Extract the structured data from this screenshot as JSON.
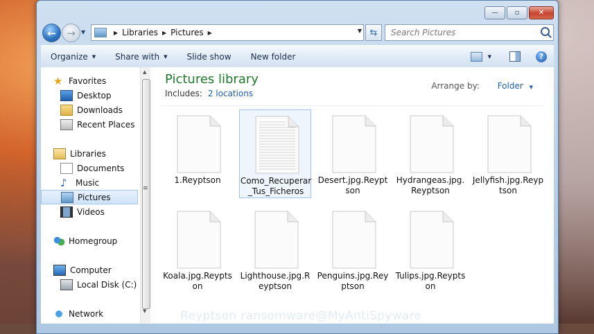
{
  "window": {
    "caption_minimize": "—",
    "caption_maximize": "▫",
    "caption_close": "✕"
  },
  "address_bar": {
    "breadcrumbs": [
      "Libraries",
      "Pictures"
    ],
    "search_placeholder": "Search Pictures"
  },
  "toolbar": {
    "organize": "Organize",
    "share_with": "Share with",
    "slide_show": "Slide show",
    "new_folder": "New folder"
  },
  "nav_pane": {
    "items": [
      {
        "label": "Favorites",
        "icon": "star-icon"
      },
      {
        "label": "Desktop",
        "icon": "desktop-icon"
      },
      {
        "label": "Downloads",
        "icon": "downloads-folder-icon"
      },
      {
        "label": "Recent Places",
        "icon": "recent-places-icon"
      },
      {
        "label": "Libraries",
        "icon": "libraries-icon"
      },
      {
        "label": "Documents",
        "icon": "documents-icon"
      },
      {
        "label": "Music",
        "icon": "music-icon"
      },
      {
        "label": "Pictures",
        "icon": "pictures-icon",
        "selected": true
      },
      {
        "label": "Videos",
        "icon": "videos-icon"
      },
      {
        "label": "Homegroup",
        "icon": "homegroup-icon"
      },
      {
        "label": "Computer",
        "icon": "computer-icon"
      },
      {
        "label": "Local Disk (C:)",
        "icon": "local-disk-icon"
      },
      {
        "label": "Network",
        "icon": "network-icon"
      }
    ]
  },
  "content": {
    "title": "Pictures library",
    "includes_label": "Includes:",
    "includes_link": "2 locations",
    "arrange_label": "Arrange by:",
    "arrange_value": "Folder",
    "files": [
      {
        "name": "1.Reyptson",
        "type": "blank"
      },
      {
        "name": "Como_Recuperar_Tus_Ficheros",
        "type": "text",
        "selected": true
      },
      {
        "name": "Desert.jpg.Reyptson",
        "type": "blank"
      },
      {
        "name": "Hydrangeas.jpg.Reyptson",
        "type": "blank"
      },
      {
        "name": "Jellyfish.jpg.Reyptson",
        "type": "blank"
      },
      {
        "name": "Koala.jpg.Reyptson",
        "type": "blank"
      },
      {
        "name": "Lighthouse.jpg.Reyptson",
        "type": "blank"
      },
      {
        "name": "Penguins.jpg.Reyptson",
        "type": "blank"
      },
      {
        "name": "Tulips.jpg.Reyptson",
        "type": "blank"
      }
    ]
  },
  "watermark": "Reyptson ransomware@MyAntiSpyware",
  "colors": {
    "library_title": "#1e7a2a",
    "link": "#2260b5",
    "selection": "#cfe3f9"
  }
}
